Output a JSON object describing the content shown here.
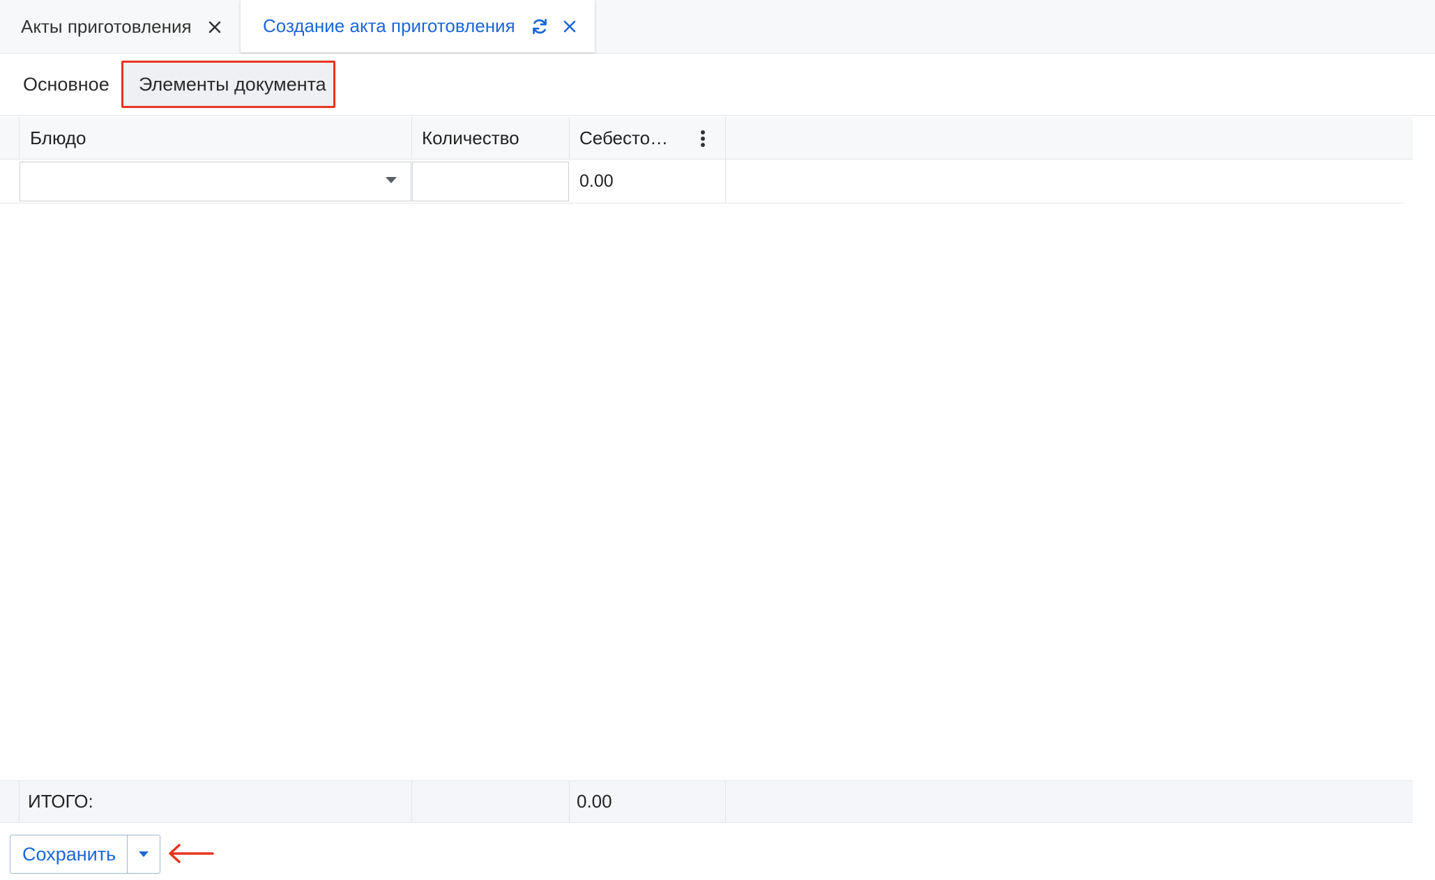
{
  "doc_tabs": [
    {
      "label": "Акты приготовления",
      "icons": [
        "close-icon"
      ]
    },
    {
      "label": "Создание акта приготовления",
      "icons": [
        "refresh-icon",
        "close-icon"
      ],
      "active": true
    }
  ],
  "section_tabs": {
    "main": "Основное",
    "items": "Элементы документа",
    "active": "items"
  },
  "grid": {
    "columns": [
      "Блюдо",
      "Количество",
      "Себесто…"
    ],
    "column_menu_icon": "kebab-menu-icon",
    "rows": [
      {
        "dish": "",
        "quantity": "",
        "cost": "0.00"
      }
    ],
    "total": {
      "label": "ИТОГО:",
      "cost": "0.00"
    }
  },
  "footer": {
    "save_label": "Сохранить",
    "save_dropdown_icon": "caret-down-icon",
    "hint_icon": "arrow-left-icon"
  },
  "colors": {
    "accent": "#1b67d6",
    "highlight": "#e8341c"
  }
}
